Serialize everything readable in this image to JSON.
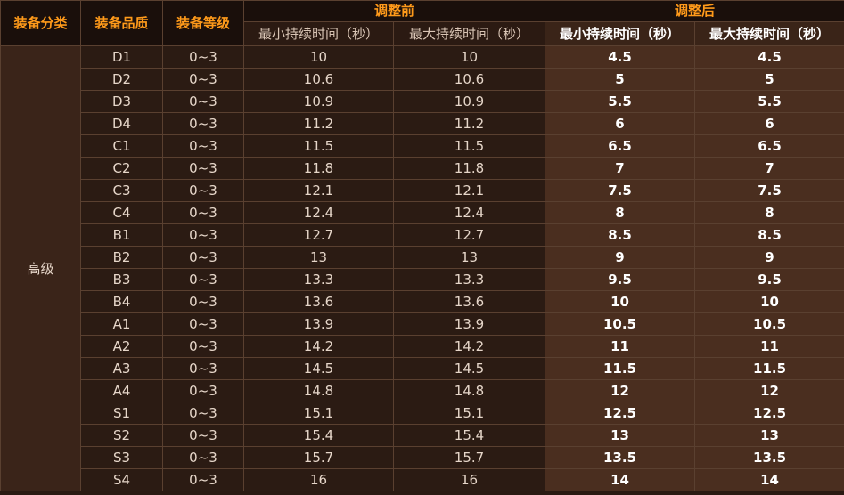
{
  "headers": {
    "category": "装备分类",
    "quality": "装备品质",
    "level": "装备等级",
    "before": "调整前",
    "after": "调整后",
    "min_dur": "最小持续时间（秒）",
    "max_dur": "最大持续时间（秒）"
  },
  "category": "高级",
  "rows": [
    {
      "quality": "D1",
      "level": "0~3",
      "before_min": "10",
      "before_max": "10",
      "after_min": "4.5",
      "after_max": "4.5"
    },
    {
      "quality": "D2",
      "level": "0~3",
      "before_min": "10.6",
      "before_max": "10.6",
      "after_min": "5",
      "after_max": "5"
    },
    {
      "quality": "D3",
      "level": "0~3",
      "before_min": "10.9",
      "before_max": "10.9",
      "after_min": "5.5",
      "after_max": "5.5"
    },
    {
      "quality": "D4",
      "level": "0~3",
      "before_min": "11.2",
      "before_max": "11.2",
      "after_min": "6",
      "after_max": "6"
    },
    {
      "quality": "C1",
      "level": "0~3",
      "before_min": "11.5",
      "before_max": "11.5",
      "after_min": "6.5",
      "after_max": "6.5"
    },
    {
      "quality": "C2",
      "level": "0~3",
      "before_min": "11.8",
      "before_max": "11.8",
      "after_min": "7",
      "after_max": "7"
    },
    {
      "quality": "C3",
      "level": "0~3",
      "before_min": "12.1",
      "before_max": "12.1",
      "after_min": "7.5",
      "after_max": "7.5"
    },
    {
      "quality": "C4",
      "level": "0~3",
      "before_min": "12.4",
      "before_max": "12.4",
      "after_min": "8",
      "after_max": "8"
    },
    {
      "quality": "B1",
      "level": "0~3",
      "before_min": "12.7",
      "before_max": "12.7",
      "after_min": "8.5",
      "after_max": "8.5"
    },
    {
      "quality": "B2",
      "level": "0~3",
      "before_min": "13",
      "before_max": "13",
      "after_min": "9",
      "after_max": "9"
    },
    {
      "quality": "B3",
      "level": "0~3",
      "before_min": "13.3",
      "before_max": "13.3",
      "after_min": "9.5",
      "after_max": "9.5"
    },
    {
      "quality": "B4",
      "level": "0~3",
      "before_min": "13.6",
      "before_max": "13.6",
      "after_min": "10",
      "after_max": "10"
    },
    {
      "quality": "A1",
      "level": "0~3",
      "before_min": "13.9",
      "before_max": "13.9",
      "after_min": "10.5",
      "after_max": "10.5"
    },
    {
      "quality": "A2",
      "level": "0~3",
      "before_min": "14.2",
      "before_max": "14.2",
      "after_min": "11",
      "after_max": "11"
    },
    {
      "quality": "A3",
      "level": "0~3",
      "before_min": "14.5",
      "before_max": "14.5",
      "after_min": "11.5",
      "after_max": "11.5"
    },
    {
      "quality": "A4",
      "level": "0~3",
      "before_min": "14.8",
      "before_max": "14.8",
      "after_min": "12",
      "after_max": "12"
    },
    {
      "quality": "S1",
      "level": "0~3",
      "before_min": "15.1",
      "before_max": "15.1",
      "after_min": "12.5",
      "after_max": "12.5"
    },
    {
      "quality": "S2",
      "level": "0~3",
      "before_min": "15.4",
      "before_max": "15.4",
      "after_min": "13",
      "after_max": "13"
    },
    {
      "quality": "S3",
      "level": "0~3",
      "before_min": "15.7",
      "before_max": "15.7",
      "after_min": "13.5",
      "after_max": "13.5"
    },
    {
      "quality": "S4",
      "level": "0~3",
      "before_min": "16",
      "before_max": "16",
      "after_min": "14",
      "after_max": "14"
    }
  ]
}
